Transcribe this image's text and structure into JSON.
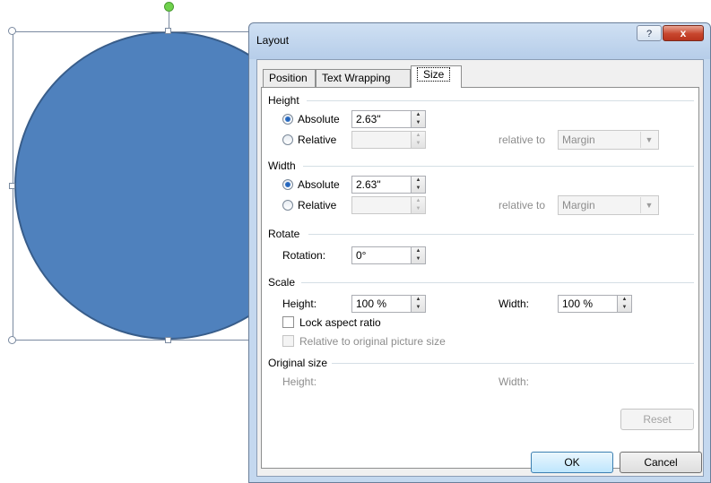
{
  "dialog": {
    "title": "Layout",
    "help_label": "?",
    "close_label": "x",
    "tabs": [
      {
        "label": "Position"
      },
      {
        "label": "Text Wrapping"
      },
      {
        "label": "Size"
      }
    ],
    "height": {
      "group_label": "Height",
      "absolute_label": "Absolute",
      "absolute_value": "2.63\"",
      "relative_label": "Relative",
      "relative_value": "",
      "relative_to_label": "relative to",
      "relative_to_value": "Margin"
    },
    "width": {
      "group_label": "Width",
      "absolute_label": "Absolute",
      "absolute_value": "2.63\"",
      "relative_label": "Relative",
      "relative_value": "",
      "relative_to_label": "relative to",
      "relative_to_value": "Margin"
    },
    "rotate": {
      "group_label": "Rotate",
      "rotation_label": "Rotation:",
      "rotation_value": "0°"
    },
    "scale": {
      "group_label": "Scale",
      "height_label": "Height:",
      "height_value": "100 %",
      "width_label": "Width:",
      "width_value": "100 %",
      "lock_aspect_label": "Lock aspect ratio",
      "relative_original_label": "Relative to original picture size"
    },
    "original_size": {
      "group_label": "Original size",
      "height_label": "Height:",
      "width_label": "Width:"
    },
    "reset_label": "Reset",
    "ok_label": "OK",
    "cancel_label": "Cancel"
  },
  "shape": {
    "fill_color": "#4f81bd",
    "outline_color": "#385d8a",
    "rotation_handle_color": "#6fd24c"
  }
}
